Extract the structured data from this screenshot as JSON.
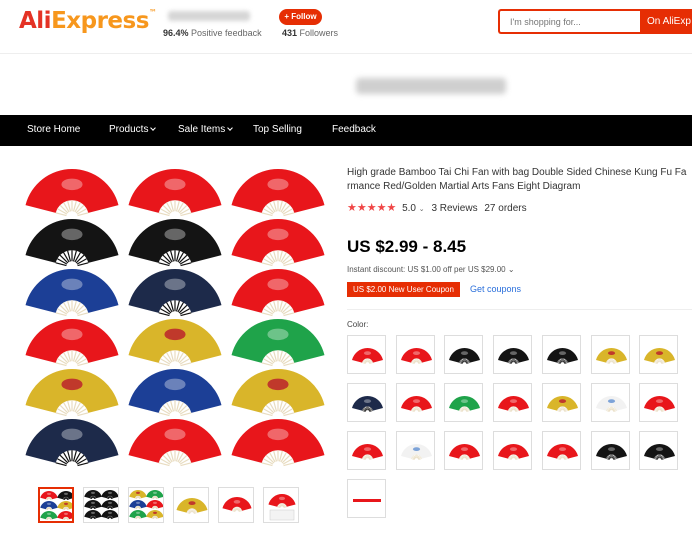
{
  "header": {
    "logo_part1": "Ali",
    "logo_part2": "Express",
    "logo_tm": "™",
    "feedback_pct": "96.4%",
    "feedback_label": "Positive feedback",
    "follow_label": "+ Follow",
    "followers_count": "431",
    "followers_label": "Followers",
    "search_placeholder": "I'm shopping for...",
    "search_button": "On AliExp"
  },
  "nav": {
    "items": [
      {
        "label": "Store Home"
      },
      {
        "label": "Products"
      },
      {
        "label": "Sale Items"
      },
      {
        "label": "Top Selling"
      },
      {
        "label": "Feedback"
      }
    ]
  },
  "product": {
    "title_line1": "High grade Bamboo Tai Chi Fan with bag Double Sided Chinese Kung Fu Fa",
    "title_line2": "rmance Red/Golden Martial Arts Fans Eight Diagram",
    "stars": "★★★★★",
    "rating": 5.0,
    "rating_label": "5.0",
    "rating_caret": "⌄",
    "reviews": "3 Reviews",
    "orders": "27 orders",
    "price": "US $2.99 - 8.45",
    "instant_discount": "Instant discount: US $1.00 off per US $29.00",
    "instant_discount_caret": "⌄",
    "coupon_tag": "US $2.00 New User Coupon",
    "get_coupons": "Get coupons",
    "color_label": "Color:"
  },
  "fan_colors": {
    "red": "#e8161b",
    "black": "#141414",
    "blue": "#1c3f96",
    "gold": "#d9b52a",
    "green": "#1fa34a",
    "darkblue": "#1d2a4a",
    "white": "#f2f2f2"
  },
  "main_image_grid": [
    [
      "red",
      "red",
      "red"
    ],
    [
      "black",
      "black",
      "red"
    ],
    [
      "blue",
      "darkblue",
      "red"
    ],
    [
      "red",
      "gold",
      "green"
    ],
    [
      "gold",
      "blue",
      "gold"
    ],
    [
      "darkblue",
      "red",
      "red"
    ]
  ],
  "thumbnails": [
    "mixed",
    "black",
    "mixed-light",
    "gold",
    "red",
    "red-bag"
  ],
  "swatches": [
    "red",
    "red",
    "black",
    "black",
    "black",
    "gold",
    "gold",
    "darkblue",
    "red",
    "green",
    "red",
    "gold",
    "white",
    "red",
    "red",
    "white",
    "red",
    "red",
    "red",
    "black",
    "black",
    "red-closed"
  ]
}
